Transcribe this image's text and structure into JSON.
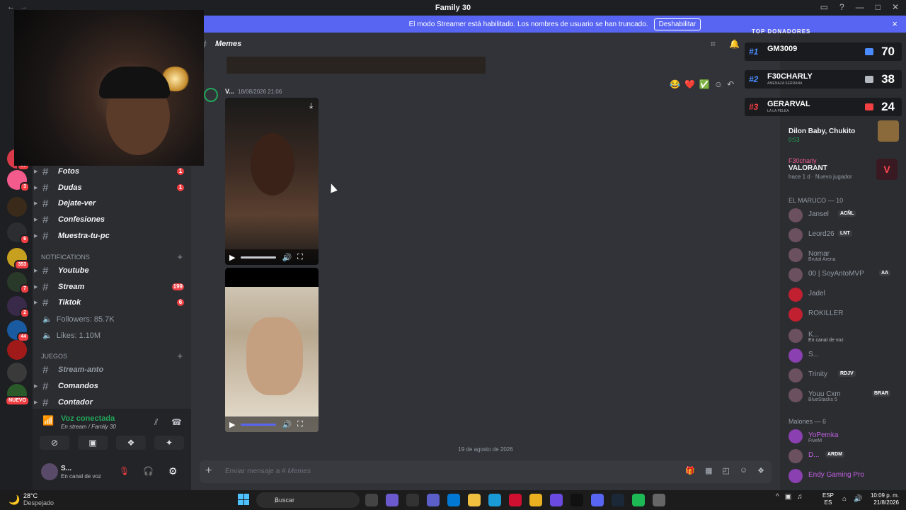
{
  "window": {
    "title": "Family 30"
  },
  "banner": {
    "text": "El modo Streamer está habilitado. Los nombres de usuario se han truncado.",
    "button": "Deshabilitar",
    "close": "×"
  },
  "guild_badges": [
    "NUEVO",
    "353",
    "7",
    "2",
    "44",
    "NUEVO",
    "3",
    "6",
    "50"
  ],
  "channels": {
    "items": [
      {
        "label": "Fotos",
        "badge": "1"
      },
      {
        "label": "Dudas",
        "badge": "1"
      },
      {
        "label": "Dejate-ver"
      },
      {
        "label": "Confesiones"
      },
      {
        "label": "Muestra-tu-pc"
      }
    ],
    "notifications_label": "NOTIFICATIONS",
    "notification_items": [
      {
        "label": "Youtube"
      },
      {
        "label": "Stream",
        "badge": "199"
      },
      {
        "label": "Tiktok",
        "badge": "6"
      }
    ],
    "followers": "Followers: 85.7K",
    "likes": "Likes: 1.10M",
    "games_label": "JUEGOS",
    "game_items": [
      {
        "label": "Stream-anto"
      },
      {
        "label": "Comandos"
      },
      {
        "label": "Contador"
      }
    ]
  },
  "voice": {
    "title": "Voz conectada",
    "subtitle": "En stream / Family 30"
  },
  "user": {
    "name": "S...",
    "status": "En canal de voz"
  },
  "chat": {
    "channel_name": "Memes",
    "author": "V...",
    "timestamp": "18/08/2026 21:06",
    "divider": "19 de agosto de 2026",
    "composer_placeholder": "Enviar mensaje a #",
    "composer_channel": "Memes",
    "reactions": [
      "😂",
      "❤️",
      "✅"
    ]
  },
  "donors": {
    "header": "TOP DONADORES",
    "list": [
      {
        "rank": "#1",
        "name": "GM3009",
        "value": "70"
      },
      {
        "rank": "#2",
        "name": "F30CHARLY",
        "sub": "AMENAZA SERRANA",
        "value": "38"
      },
      {
        "rank": "#3",
        "name": "GERARVAL",
        "sub": "LA LA PELEA",
        "value": "24"
      }
    ]
  },
  "members": {
    "activity1": {
      "name": "Dilon Baby, Chukito",
      "time": "0:53"
    },
    "activity2": {
      "user": "F30charly",
      "game": "VALORANT",
      "meta": "hace 1 d",
      "extra": "Nuevo jugador"
    },
    "group1": "EL MARUCO — 10",
    "list1": [
      {
        "name": "Jansel",
        "tag": "ACÑL"
      },
      {
        "name": "Leord26",
        "tag": "LNT"
      },
      {
        "name": "Nomar",
        "sub": "Brutal Arena"
      },
      {
        "name": "00 | SoyAntoMVP",
        "tag": "AA"
      },
      {
        "name": "Jadel"
      },
      {
        "name": "ROKILLER"
      },
      {
        "name": "K...",
        "sub": "En canal de voz"
      },
      {
        "name": "S..."
      },
      {
        "name": "Trinity",
        "tag": "RDJV"
      },
      {
        "name": "Youu Cxm",
        "tag": "BRAR",
        "sub": "BlueStacks 5"
      }
    ],
    "group2": "Malones — 6",
    "list2": [
      {
        "name": "YoPemka",
        "sub": "FiveM"
      },
      {
        "name": "D...",
        "tag": "ARDM"
      },
      {
        "name": "Endy Gaming Pro"
      }
    ]
  },
  "taskbar": {
    "temp": "28°C",
    "weather": "Despejado",
    "search": "Buscar",
    "lang1": "ESP",
    "lang2": "ES",
    "time": "10:09 p. m.",
    "date": "21/8/2026"
  }
}
